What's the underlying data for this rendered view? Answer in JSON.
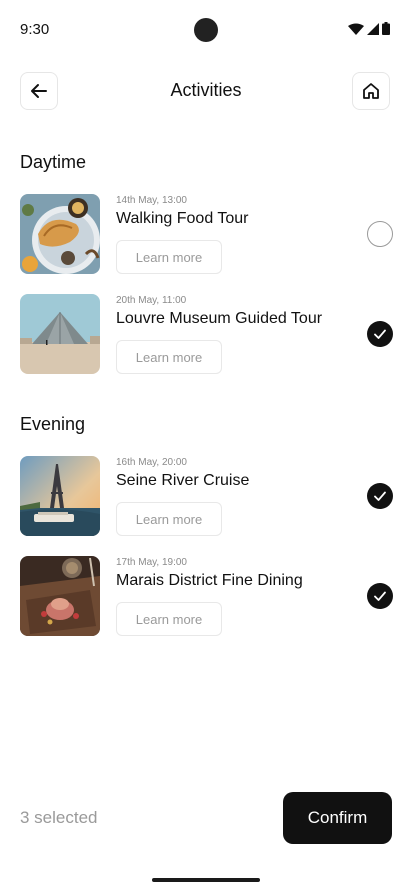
{
  "status_bar": {
    "time": "9:30",
    "icons": [
      "wifi-icon",
      "signal-icon",
      "battery-icon"
    ]
  },
  "header": {
    "title": "Activities",
    "back_icon": "arrow-left-icon",
    "home_icon": "home-icon"
  },
  "sections": [
    {
      "title": "Daytime",
      "items": [
        {
          "date": "14th May, 13:00",
          "title": "Walking Food Tour",
          "learn_more": "Learn more",
          "selected": false,
          "image": "croissant-breakfast-photo"
        },
        {
          "date": "20th May, 11:00",
          "title": "Louvre Museum Guided Tour",
          "learn_more": "Learn more",
          "selected": true,
          "image": "louvre-pyramid-photo"
        }
      ]
    },
    {
      "title": "Evening",
      "items": [
        {
          "date": "16th May, 20:00",
          "title": "Seine River Cruise",
          "learn_more": "Learn more",
          "selected": true,
          "image": "eiffel-tower-river-photo"
        },
        {
          "date": "17th May, 19:00",
          "title": "Marais District Fine Dining",
          "learn_more": "Learn more",
          "selected": true,
          "image": "fine-dining-plate-photo"
        }
      ]
    }
  ],
  "footer": {
    "selected_count": "3 selected",
    "confirm_label": "Confirm"
  },
  "colors": {
    "accent": "#111111",
    "muted_text": "#9a9a9a",
    "border": "#e8e8e8"
  }
}
